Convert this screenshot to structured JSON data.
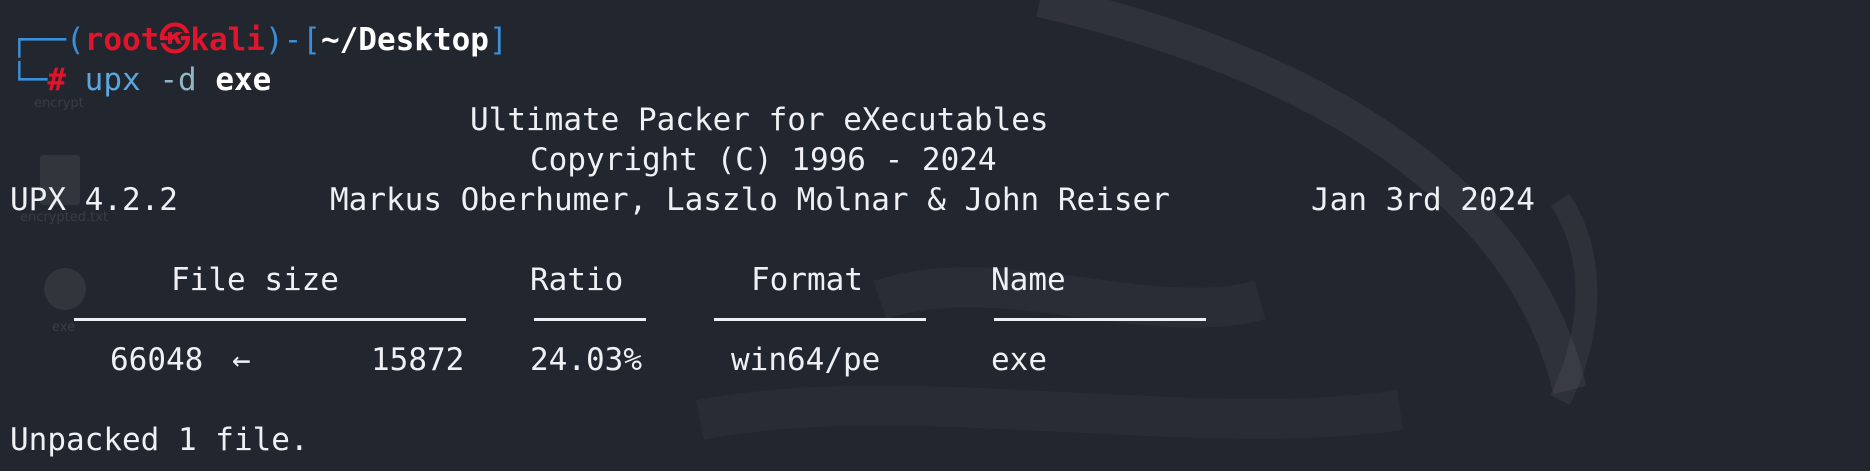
{
  "prompt": {
    "top_left": "┌──(",
    "user": "root",
    "at_symbol": "㉿",
    "host": "kali",
    "mid": ")-[",
    "cwd": "~/Desktop",
    "end": "]",
    "bottom_left": "└─",
    "hash": "#",
    "command": "upx",
    "flag": "-d",
    "argument": "exe"
  },
  "banner": {
    "title": "Ultimate Packer for eXecutables",
    "copyright": "Copyright (C) 1996 - 2024",
    "version": "UPX 4.2.2",
    "authors": "Markus Oberhumer, Laszlo Molnar & John Reiser",
    "date": "Jan 3rd 2024"
  },
  "table": {
    "headers": {
      "file_size": "File size",
      "ratio": "Ratio",
      "format": "Format",
      "name": "Name"
    },
    "row": {
      "original_size": "66048",
      "arrow": "←",
      "packed_size": "15872",
      "ratio": "24.03%",
      "format": "win64/pe",
      "name": "exe"
    }
  },
  "result": "Unpacked 1 file.",
  "desktop_icons": [
    "encrypt",
    "encrypted.txt",
    "exe"
  ]
}
